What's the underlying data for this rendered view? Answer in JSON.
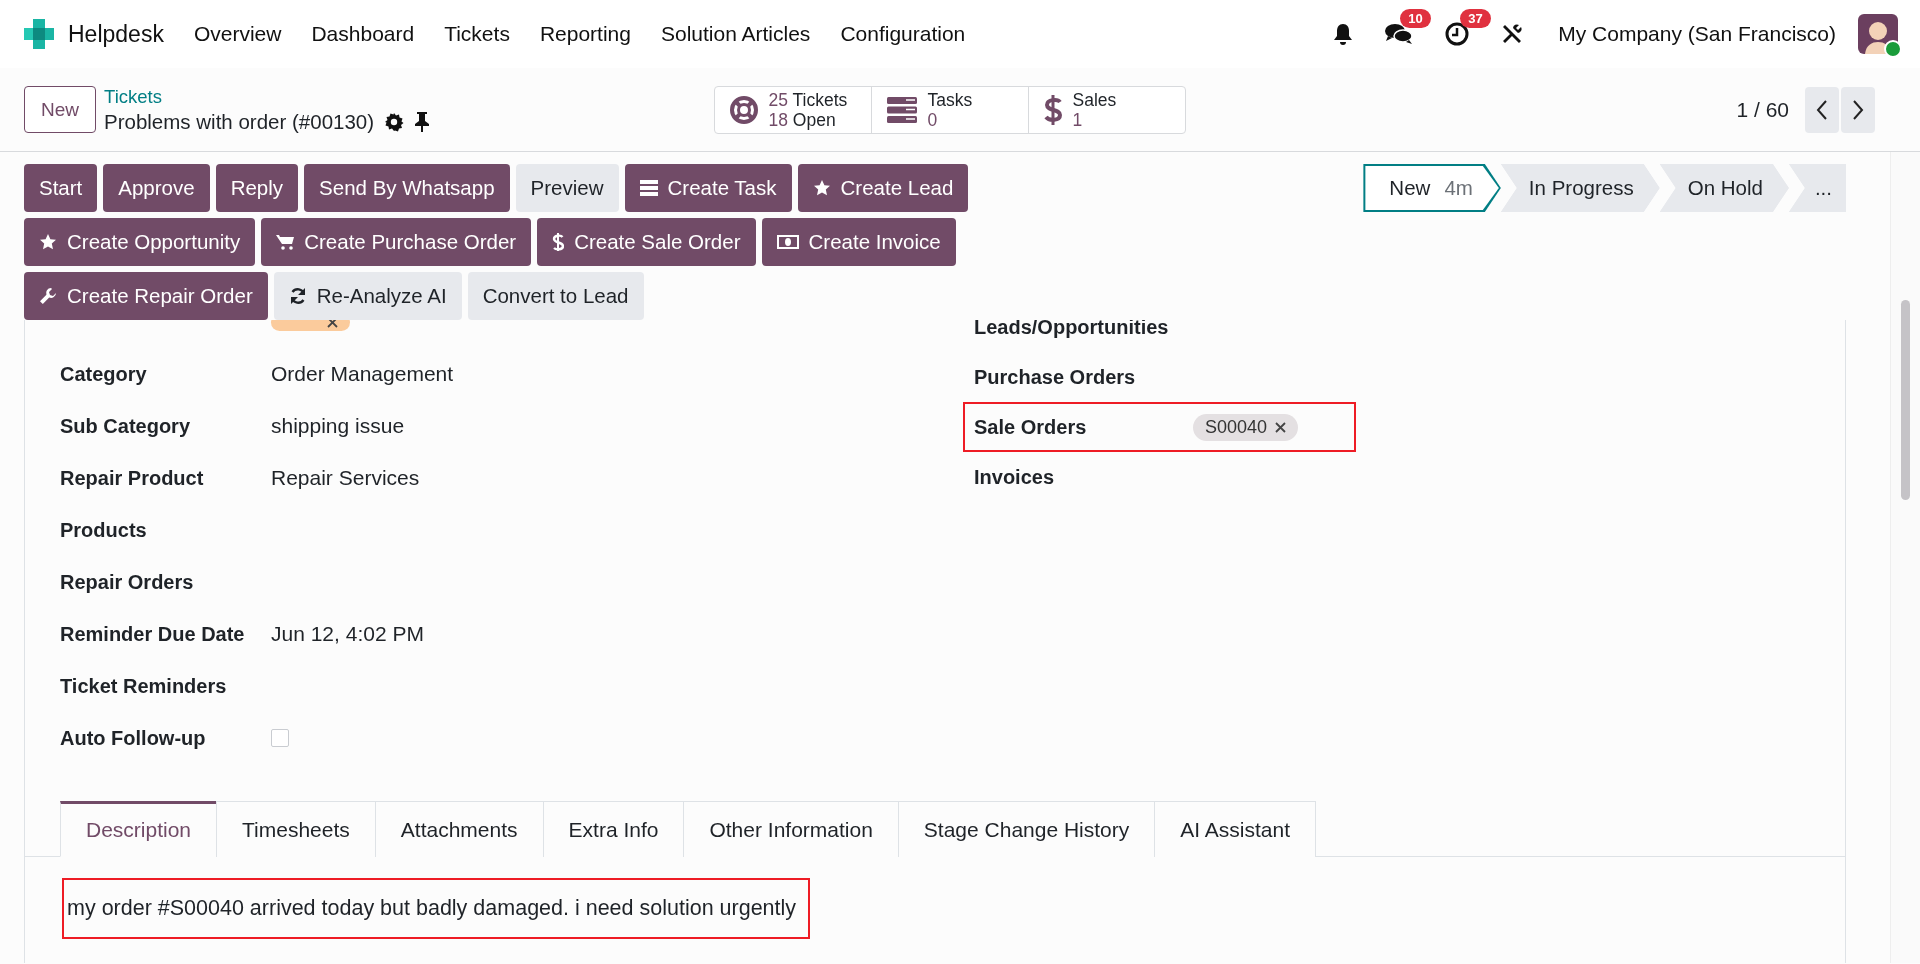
{
  "navbar": {
    "app_name": "Helpdesk",
    "menu": [
      "Overview",
      "Dashboard",
      "Tickets",
      "Reporting",
      "Solution Articles",
      "Configuration"
    ],
    "systray": [
      {
        "kind": "bell"
      },
      {
        "kind": "chat",
        "badge": "10"
      },
      {
        "kind": "activity",
        "badge": "37"
      },
      {
        "kind": "tools"
      }
    ],
    "company": "My Company (San Francisco)",
    "user_online": true
  },
  "control_panel": {
    "new_button": "New",
    "breadcrumb": "Tickets",
    "record_title": "Problems with order (#00130)",
    "stat_buttons": [
      {
        "kind": "tickets",
        "rows": [
          {
            "count": "25",
            "caption": "Tickets"
          },
          {
            "count": "18",
            "caption": "Open"
          }
        ]
      },
      {
        "kind": "tasks",
        "rows": [
          {
            "caption": "Tasks"
          },
          {
            "count": "0"
          }
        ]
      },
      {
        "kind": "sales",
        "rows": [
          {
            "caption": "Sales"
          },
          {
            "count": "1"
          }
        ]
      }
    ],
    "pager": "1 / 60"
  },
  "action_rows": [
    [
      {
        "label": "Start",
        "kind": "plain",
        "primary": true
      },
      {
        "label": "Approve",
        "kind": "plain",
        "primary": true
      },
      {
        "label": "Reply",
        "kind": "plain",
        "primary": true
      },
      {
        "label": "Send By Whatsapp",
        "kind": "plain",
        "primary": true
      },
      {
        "label": "Preview",
        "kind": "plain",
        "primary": false
      },
      {
        "label": "Create Task",
        "kind": "task",
        "primary": true
      },
      {
        "label": "Create Lead",
        "kind": "star",
        "primary": true
      }
    ],
    [
      {
        "label": "Create Opportunity",
        "kind": "star",
        "primary": true
      },
      {
        "label": "Create Purchase Order",
        "kind": "cart",
        "primary": true
      },
      {
        "label": "Create Sale Order",
        "kind": "dollar",
        "primary": true
      },
      {
        "label": "Create Invoice",
        "kind": "money",
        "primary": true
      }
    ],
    [
      {
        "label": "Create Repair Order",
        "kind": "wrench",
        "primary": true
      },
      {
        "label": "Re-Analyze AI",
        "kind": "refresh",
        "primary": false
      },
      {
        "label": "Convert to Lead",
        "kind": "plain",
        "primary": false
      }
    ]
  ],
  "stages": [
    {
      "label": "New",
      "time": "4m",
      "selected": true
    },
    {
      "label": "In Progress",
      "selected": false
    },
    {
      "label": "On Hold",
      "selected": false
    },
    {
      "label": "...",
      "selected": false
    }
  ],
  "form": {
    "left_fields": [
      {
        "kind": "tags",
        "tags": [
          {
            "color": "#fbcb9c"
          }
        ]
      },
      {
        "label": "Category",
        "kind": "text",
        "value": "Order Management"
      },
      {
        "label": "Sub Category",
        "kind": "text",
        "value": "shipping issue"
      },
      {
        "label": "Repair Product",
        "kind": "text",
        "value": "Repair Services"
      },
      {
        "label": "Products",
        "kind": "empty"
      },
      {
        "label": "Repair Orders",
        "kind": "empty"
      },
      {
        "label": "Reminder Due Date",
        "kind": "text",
        "value": "Jun 12, 4:02 PM"
      },
      {
        "label": "Ticket Reminders",
        "kind": "empty"
      },
      {
        "label": "Auto Follow-up",
        "kind": "checkbox",
        "checked": false
      }
    ],
    "right_fields": [
      {
        "label": "Leads/Opportunities",
        "kind": "empty",
        "highlighted": false
      },
      {
        "label": "Purchase Orders",
        "kind": "empty",
        "highlighted": false
      },
      {
        "label": "Sale Orders",
        "kind": "tags",
        "tags": [
          {
            "text": "S00040",
            "color": "#e4e0e2"
          }
        ],
        "highlighted": true
      },
      {
        "label": "Invoices",
        "kind": "empty",
        "highlighted": false
      }
    ]
  },
  "tabs": [
    {
      "label": "Description",
      "selected": true
    },
    {
      "label": "Timesheets",
      "selected": false
    },
    {
      "label": "Attachments",
      "selected": false
    },
    {
      "label": "Extra Info",
      "selected": false
    },
    {
      "label": "Other Information",
      "selected": false
    },
    {
      "label": "Stage Change History",
      "selected": false
    },
    {
      "label": "AI Assistant",
      "selected": false
    }
  ],
  "description": {
    "text": "my order #S00040 arrived today but badly damaged. i need solution urgently",
    "highlighted": true
  }
}
